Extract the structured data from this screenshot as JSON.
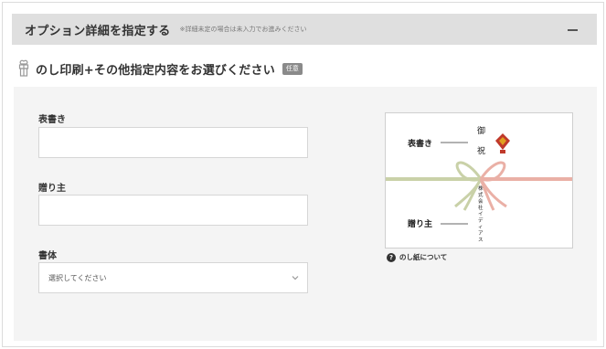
{
  "header": {
    "title": "オプション詳細を指定する",
    "note": "※詳細未定の場合は未入力でお進みください",
    "collapse_icon": "minus-icon"
  },
  "section": {
    "icon": "gift-icon",
    "title": "のし印刷+その他指定内容をお選びください",
    "badge": "任意"
  },
  "form": {
    "omotegaki_label": "表書き",
    "omotegaki_value": "",
    "okurinushi_label": "贈り主",
    "okurinushi_value": "",
    "font_label": "書体",
    "font_select_value": "選択してください"
  },
  "noshi_example": {
    "omotegaki_label": "表書き",
    "okurinushi_label": "贈り主",
    "example_text_top": [
      "御",
      "祝"
    ],
    "example_text_bottom": "株式会社イディアス",
    "colors": {
      "ribbon_green": "#c9d1a8",
      "ribbon_pink": "#eab0a6",
      "noshi_red": "#c0392b",
      "noshi_gold": "#e0a020"
    }
  },
  "help": {
    "icon": "question-icon",
    "label": "のし紙について"
  }
}
